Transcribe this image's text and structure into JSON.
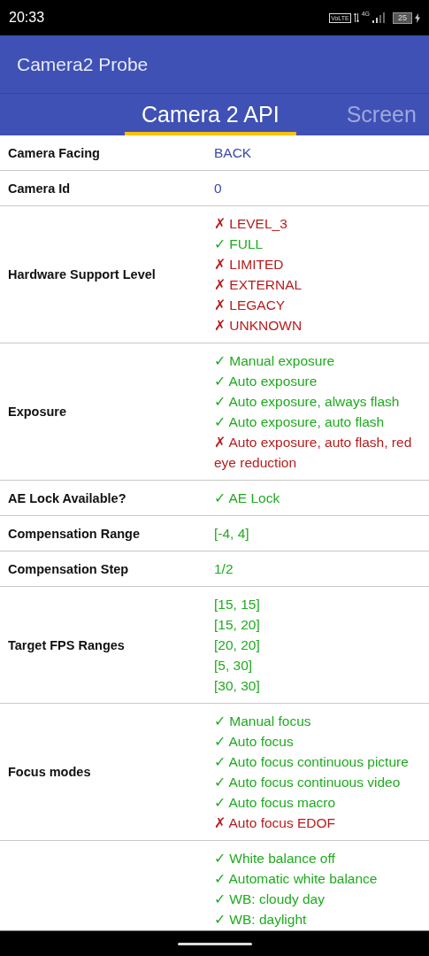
{
  "status_bar": {
    "time": "20:33",
    "volte": "VoLTE",
    "network": "4G",
    "battery": "25",
    "charging": true
  },
  "app_bar": {
    "title": "Camera2 Probe"
  },
  "tabs": [
    {
      "label": "Camera 2 API",
      "selected": true
    },
    {
      "label": "Screen",
      "selected": false
    }
  ],
  "table": {
    "rows": [
      {
        "label": "Camera Facing",
        "values": [
          {
            "kind": "enum",
            "text": "BACK"
          }
        ]
      },
      {
        "label": "Camera Id",
        "values": [
          {
            "kind": "enum",
            "text": "0"
          }
        ]
      },
      {
        "label": "Hardware Support Level",
        "values": [
          {
            "kind": "check",
            "text": "✗ LEVEL_3",
            "supported": false
          },
          {
            "kind": "check",
            "text": "✓ FULL",
            "supported": true
          },
          {
            "kind": "check",
            "text": "✗ LIMITED",
            "supported": false
          },
          {
            "kind": "check",
            "text": "✗ EXTERNAL",
            "supported": false
          },
          {
            "kind": "check",
            "text": "✗ LEGACY",
            "supported": false
          },
          {
            "kind": "check",
            "text": "✗ UNKNOWN",
            "supported": false
          }
        ]
      },
      {
        "label": "Exposure",
        "values": [
          {
            "kind": "check",
            "text": "✓ Manual exposure",
            "supported": true
          },
          {
            "kind": "check",
            "text": "✓ Auto exposure",
            "supported": true
          },
          {
            "kind": "check",
            "text": "✓ Auto exposure, always flash",
            "supported": true
          },
          {
            "kind": "check",
            "text": "✓ Auto exposure, auto flash",
            "supported": true
          },
          {
            "kind": "check",
            "text": "✗ Auto exposure, auto flash, red eye reduction",
            "supported": false
          }
        ]
      },
      {
        "label": "AE Lock Available?",
        "values": [
          {
            "kind": "check",
            "text": "✓ AE Lock",
            "supported": true
          }
        ]
      },
      {
        "label": "Compensation Range",
        "values": [
          {
            "kind": "value",
            "text": "[-4, 4]"
          }
        ]
      },
      {
        "label": "Compensation Step",
        "values": [
          {
            "kind": "value",
            "text": "1/2"
          }
        ]
      },
      {
        "label": "Target FPS Ranges",
        "values": [
          {
            "kind": "value",
            "text": "[15, 15]"
          },
          {
            "kind": "value",
            "text": "[15, 20]"
          },
          {
            "kind": "value",
            "text": "[20, 20]"
          },
          {
            "kind": "value",
            "text": "[5, 30]"
          },
          {
            "kind": "value",
            "text": "[30, 30]"
          }
        ]
      },
      {
        "label": "Focus modes",
        "values": [
          {
            "kind": "check",
            "text": "✓ Manual focus",
            "supported": true
          },
          {
            "kind": "check",
            "text": "✓ Auto focus",
            "supported": true
          },
          {
            "kind": "check",
            "text": "✓ Auto focus continuous picture",
            "supported": true
          },
          {
            "kind": "check",
            "text": "✓ Auto focus continuous video",
            "supported": true
          },
          {
            "kind": "check",
            "text": "✓ Auto focus macro",
            "supported": true
          },
          {
            "kind": "check",
            "text": "✗ Auto focus EDOF",
            "supported": false
          }
        ]
      },
      {
        "values": [
          {
            "kind": "check",
            "text": "✓ White balance off",
            "supported": true
          },
          {
            "kind": "check",
            "text": "✓ Automatic white balance",
            "supported": true
          },
          {
            "kind": "check",
            "text": "✓ WB: cloudy day",
            "supported": true
          },
          {
            "kind": "check",
            "text": "✓ WB: daylight",
            "supported": true
          }
        ]
      }
    ]
  }
}
